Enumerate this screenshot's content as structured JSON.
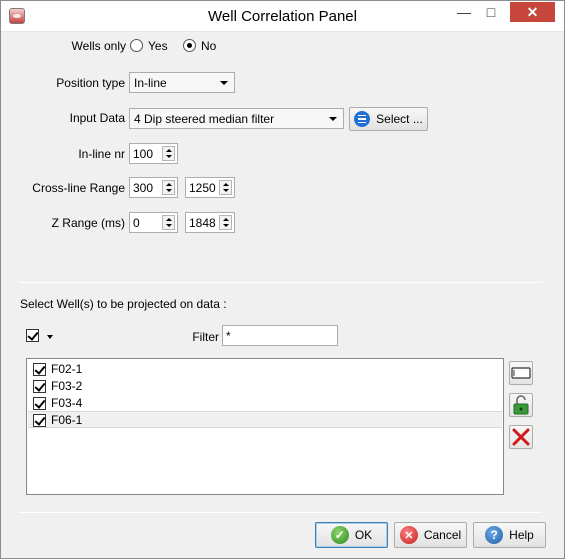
{
  "window": {
    "title": "Well Correlation Panel",
    "min_glyph": "—",
    "max_glyph": "□",
    "close_glyph": "✕"
  },
  "wells_only": {
    "label": "Wells only",
    "yes_label": "Yes",
    "no_label": "No",
    "selected": "No"
  },
  "position_type": {
    "label": "Position type",
    "value": "In-line"
  },
  "input_data": {
    "label": "Input Data",
    "value": "4 Dip steered median filter",
    "select_button": "Select ..."
  },
  "inline_nr": {
    "label": "In-line nr",
    "value": "100"
  },
  "crossline_range": {
    "label": "Cross-line Range",
    "start": "300",
    "stop": "1250"
  },
  "z_range": {
    "label": "Z Range (ms)",
    "start": "0",
    "stop": "1848"
  },
  "wells_section": {
    "heading": "Select Well(s) to be projected on data :",
    "filter_label": "Filter",
    "filter_value": "*",
    "wells": [
      {
        "name": "F02-1",
        "checked": true
      },
      {
        "name": "F03-2",
        "checked": true
      },
      {
        "name": "F03-4",
        "checked": true
      },
      {
        "name": "F06-1",
        "checked": true
      }
    ]
  },
  "buttons": {
    "ok": "OK",
    "cancel": "Cancel",
    "help": "Help"
  },
  "icon_names": [
    "app-icon",
    "minimize-icon",
    "maximize-icon",
    "close-icon",
    "select-list-icon",
    "spin-up-down-icon",
    "chevron-down-icon",
    "rename-icon",
    "unlock-icon",
    "delete-x-icon",
    "ok-check-icon",
    "cancel-x-icon",
    "help-question-icon"
  ],
  "colors": {
    "close_button": "#c7463c",
    "ok_green": "#2e8b1f",
    "cancel_red": "#c02020",
    "help_blue": "#1f5fa8",
    "select_icon_blue": "#1e6fd6"
  }
}
